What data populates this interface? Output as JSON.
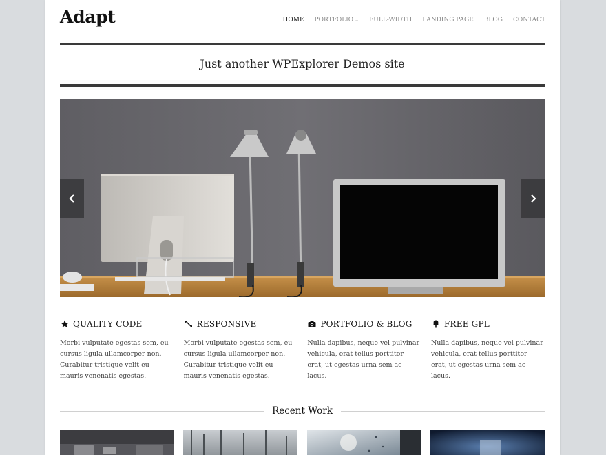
{
  "site": {
    "logo": "Adapt",
    "tagline": "Just another WPExplorer Demos site"
  },
  "nav": {
    "items": [
      {
        "label": "HOME",
        "active": true
      },
      {
        "label": "PORTFOLIO",
        "has_dropdown": true
      },
      {
        "label": "FULL-WIDTH"
      },
      {
        "label": "LANDING PAGE"
      },
      {
        "label": "BLOG"
      },
      {
        "label": "CONTACT"
      }
    ]
  },
  "slider": {
    "prev_icon": "chevron-left-icon",
    "next_icon": "chevron-right-icon"
  },
  "features": [
    {
      "icon": "star-icon",
      "title": "QUALITY CODE",
      "text": "Morbi vulputate egestas sem, eu cursus ligula ullamcorper non. Curabitur tristique velit eu mauris venenatis egestas."
    },
    {
      "icon": "expand-icon",
      "title": "RESPONSIVE",
      "text": "Morbi vulputate egestas sem, eu cursus ligula ullamcorper non. Curabitur tristique velit eu mauris venenatis egestas."
    },
    {
      "icon": "camera-icon",
      "title": "PORTFOLIO & BLOG",
      "text": "Nulla dapibus, neque vel pulvinar vehicula, erat tellus porttitor erat, ut egestas urna sem ac lacus."
    },
    {
      "icon": "tree-icon",
      "title": "FREE GPL",
      "text": "Nulla dapibus, neque vel pulvinar vehicula, erat tellus porttitor erat, ut egestas urna sem ac lacus."
    }
  ],
  "recent_work": {
    "title": "Recent Work"
  },
  "colors": {
    "rule": "#3a3a3a",
    "wall": "#6b6a6e",
    "desk": "#b7843f",
    "background": "#d9dcdf"
  }
}
